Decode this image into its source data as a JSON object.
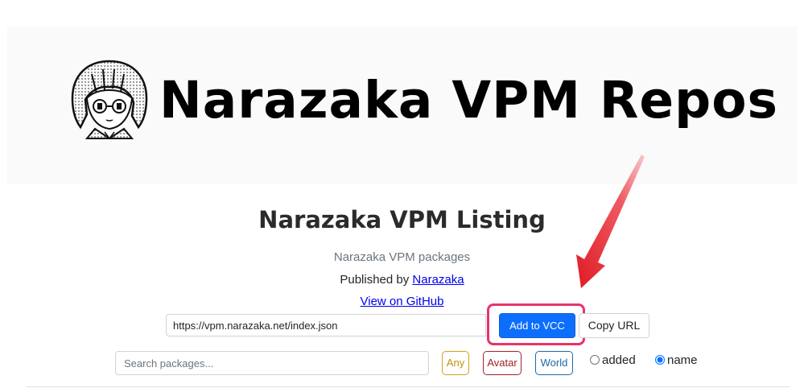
{
  "banner": {
    "title": "Narazaka VPM Repos",
    "logo_icon": "anime-character-logo-icon"
  },
  "listing": {
    "title": "Narazaka VPM Listing",
    "subtitle": "Narazaka VPM packages",
    "published_prefix": "Published by ",
    "author_link": "Narazaka",
    "github_link": "View on GitHub"
  },
  "url_row": {
    "url_value": "https://vpm.narazaka.net/index.json",
    "add_vcc_label": "Add to VCC",
    "copy_url_label": "Copy URL"
  },
  "filters": {
    "search_placeholder": "Search packages...",
    "tags": [
      "Any",
      "Avatar",
      "World"
    ],
    "sort_options": [
      "added",
      "name"
    ],
    "sort_selected": "name"
  },
  "annotation": {
    "arrow_color": "#e8262f",
    "highlight_color": "#e8336b"
  },
  "colors": {
    "primary": "#0d6efd",
    "tag_any": "#c39006",
    "tag_avatar": "#a0232a",
    "tag_world": "#1d6aa5"
  }
}
